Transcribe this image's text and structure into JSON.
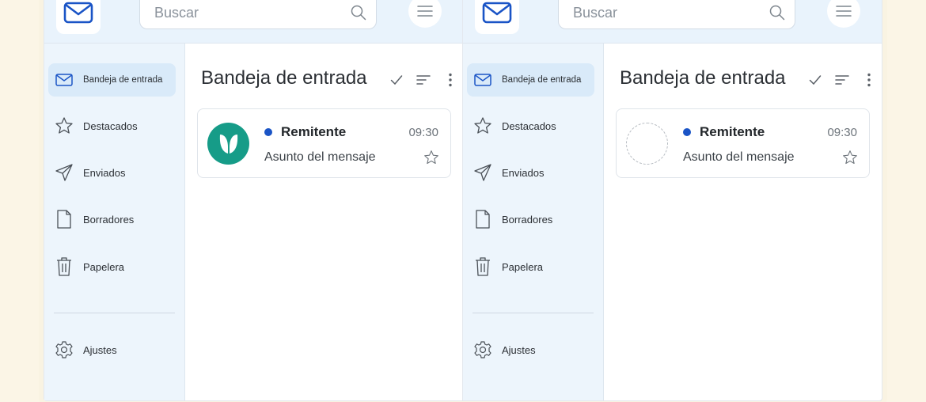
{
  "panes": [
    {
      "search": {
        "placeholder": "Buscar"
      },
      "sidebar": {
        "items": [
          {
            "label": "Bandeja de entrada",
            "icon": "mail-icon",
            "active": true
          },
          {
            "label": "Destacados",
            "icon": "star-icon"
          },
          {
            "label": "Enviados",
            "icon": "send-icon"
          },
          {
            "label": "Borradores",
            "icon": "document-icon"
          },
          {
            "label": "Papelera",
            "icon": "trash-icon"
          }
        ],
        "settings_label": "Ajustes"
      },
      "main": {
        "title": "Bandeja de entrada",
        "message": {
          "sender": "Remitente",
          "time": "09:30",
          "subject": "Asunto del mensaje",
          "avatar": "leaf-logo-avatar"
        }
      }
    },
    {
      "search": {
        "placeholder": "Buscar"
      },
      "sidebar": {
        "items": [
          {
            "label": "Bandeja de entrada",
            "icon": "mail-icon",
            "active": true
          },
          {
            "label": "Destacados",
            "icon": "star-icon"
          },
          {
            "label": "Enviados",
            "icon": "send-icon"
          },
          {
            "label": "Borradores",
            "icon": "document-icon"
          },
          {
            "label": "Papelera",
            "icon": "trash-icon"
          }
        ],
        "settings_label": "Ajustes"
      },
      "main": {
        "title": "Bandeja de entrada",
        "message": {
          "sender": "Remitente",
          "time": "09:30",
          "subject": "Asunto del mensaje",
          "avatar": "placeholder-avatar"
        }
      }
    }
  ],
  "colors": {
    "background": "#fbf5e6",
    "header": "#e9f3fc",
    "sidebar": "#edf5fc",
    "active_item": "#d9eaf9",
    "accent": "#1a54c6",
    "avatar_green": "#169c88"
  }
}
